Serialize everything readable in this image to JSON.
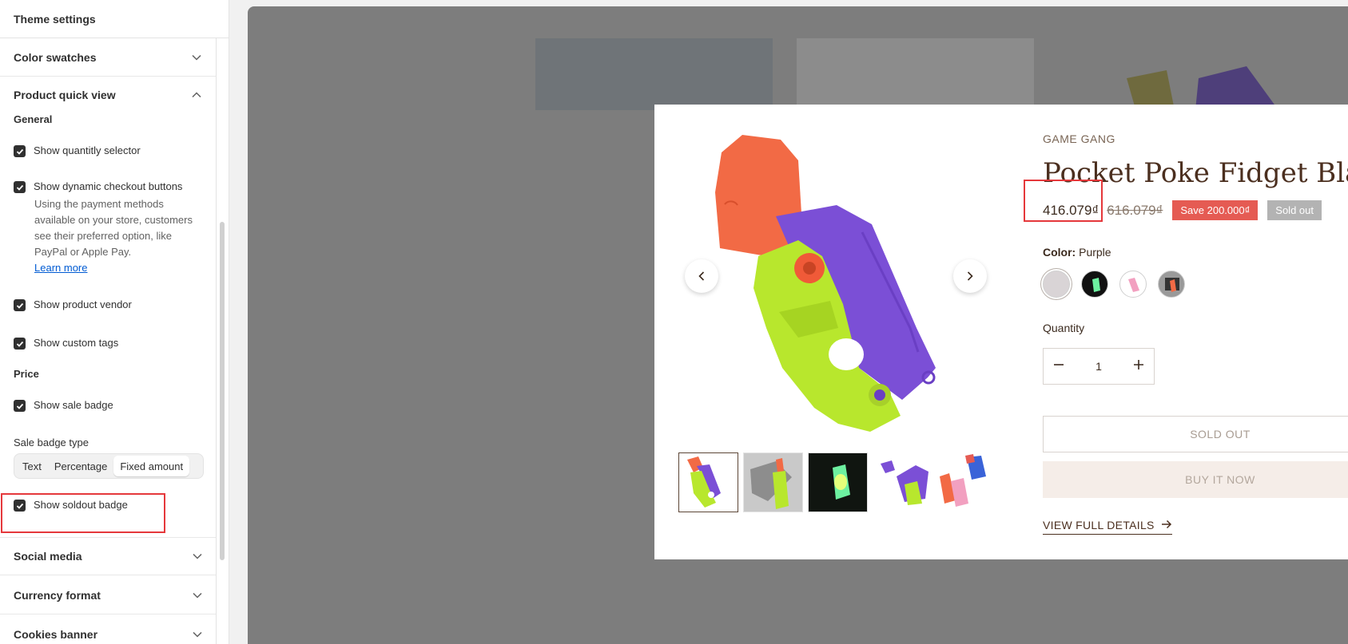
{
  "sidebar": {
    "title": "Theme settings",
    "sections": {
      "color_swatches": "Color swatches",
      "product_quick_view": "Product quick view",
      "social_media": "Social media",
      "currency_format": "Currency format",
      "cookies_banner": "Cookies banner"
    },
    "general_heading": "General",
    "price_heading": "Price",
    "checkboxes": {
      "quantity": "Show quantitly selector",
      "dynamic_checkout": "Show dynamic checkout buttons",
      "vendor": "Show product vendor",
      "custom_tags": "Show custom tags",
      "sale_badge": "Show sale badge",
      "soldout_badge": "Show soldout badge"
    },
    "dynamic_help": "Using the payment methods available on your store, customers see their preferred option, like PayPal or Apple Pay.",
    "learn_more": "Learn more",
    "sale_badge_type_label": "Sale badge type",
    "sale_badge_type_options": [
      "Text",
      "Percentage",
      "Fixed amount"
    ],
    "sale_badge_type_selected": "Fixed amount",
    "highlight_color": "#e5383b"
  },
  "product": {
    "vendor": "GAME GANG",
    "title": "Pocket Poke Fidget Blade",
    "price": "416.079₫",
    "compare_price": "616.079₫",
    "sale_badge": "Save 200.000₫",
    "sold_badge": "Sold out",
    "color_label": "Color:",
    "color_value": "Purple",
    "quantity_label": "Quantity",
    "quantity_value": "1",
    "sold_out_button": "SOLD OUT",
    "buy_now_button": "BUY IT NOW",
    "view_full": "VIEW FULL DETAILS",
    "colors": {
      "title": "#4b2f1f",
      "sale_badge": "#e55b53",
      "sold_badge": "#b3b3b3"
    }
  }
}
